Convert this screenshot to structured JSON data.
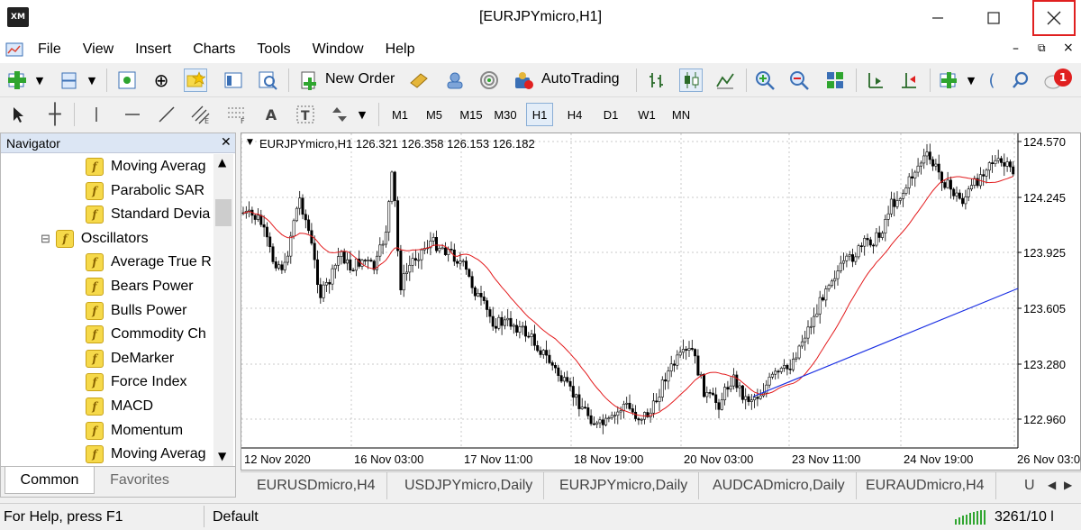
{
  "window": {
    "title": "[EURJPYmicro,H1]",
    "logo": "XM"
  },
  "menu": [
    "File",
    "View",
    "Insert",
    "Charts",
    "Tools",
    "Window",
    "Help"
  ],
  "toolbar": {
    "new_order": "New Order",
    "autotrading": "AutoTrading",
    "notification_count": "1"
  },
  "timeframes": [
    "M1",
    "M5",
    "M15",
    "M30",
    "H1",
    "H4",
    "D1",
    "W1",
    "MN"
  ],
  "active_timeframe": "H1",
  "navigator": {
    "title": "Navigator",
    "items": [
      {
        "label": "Moving Averag",
        "indent": 2
      },
      {
        "label": "Parabolic SAR",
        "indent": 2
      },
      {
        "label": "Standard Devia",
        "indent": 2
      },
      {
        "label": "Oscillators",
        "indent": 1
      },
      {
        "label": "Average True R",
        "indent": 2
      },
      {
        "label": "Bears Power",
        "indent": 2
      },
      {
        "label": "Bulls Power",
        "indent": 2
      },
      {
        "label": "Commodity Ch",
        "indent": 2
      },
      {
        "label": "DeMarker",
        "indent": 2
      },
      {
        "label": "Force Index",
        "indent": 2
      },
      {
        "label": "MACD",
        "indent": 2
      },
      {
        "label": "Momentum",
        "indent": 2
      },
      {
        "label": "Moving Averag",
        "indent": 2
      }
    ],
    "tabs": [
      "Common",
      "Favorites"
    ]
  },
  "chart": {
    "header": "EURJPYmicro,H1  126.321 126.358 126.153 126.182",
    "price_labels": [
      "124.570",
      "124.245",
      "123.925",
      "123.605",
      "123.280",
      "122.960"
    ],
    "date_labels": [
      "12 Nov 2020",
      "16 Nov 03:00",
      "17 Nov 11:00",
      "18 Nov 19:00",
      "20 Nov 03:00",
      "23 Nov 11:00",
      "24 Nov 19:00",
      "26 Nov 03:00"
    ],
    "colors": {
      "ma": "#e31a1c",
      "trendline": "#1a2fe3",
      "candles": "#000000"
    }
  },
  "chart_tabs": [
    "EURUSDmicro,H4",
    "USDJPYmicro,Daily",
    "EURJPYmicro,Daily",
    "AUDCADmicro,Daily",
    "EURAUDmicro,H4",
    "U"
  ],
  "status": {
    "help": "For Help, press F1",
    "profile": "Default",
    "traffic": "3261/10 l"
  }
}
